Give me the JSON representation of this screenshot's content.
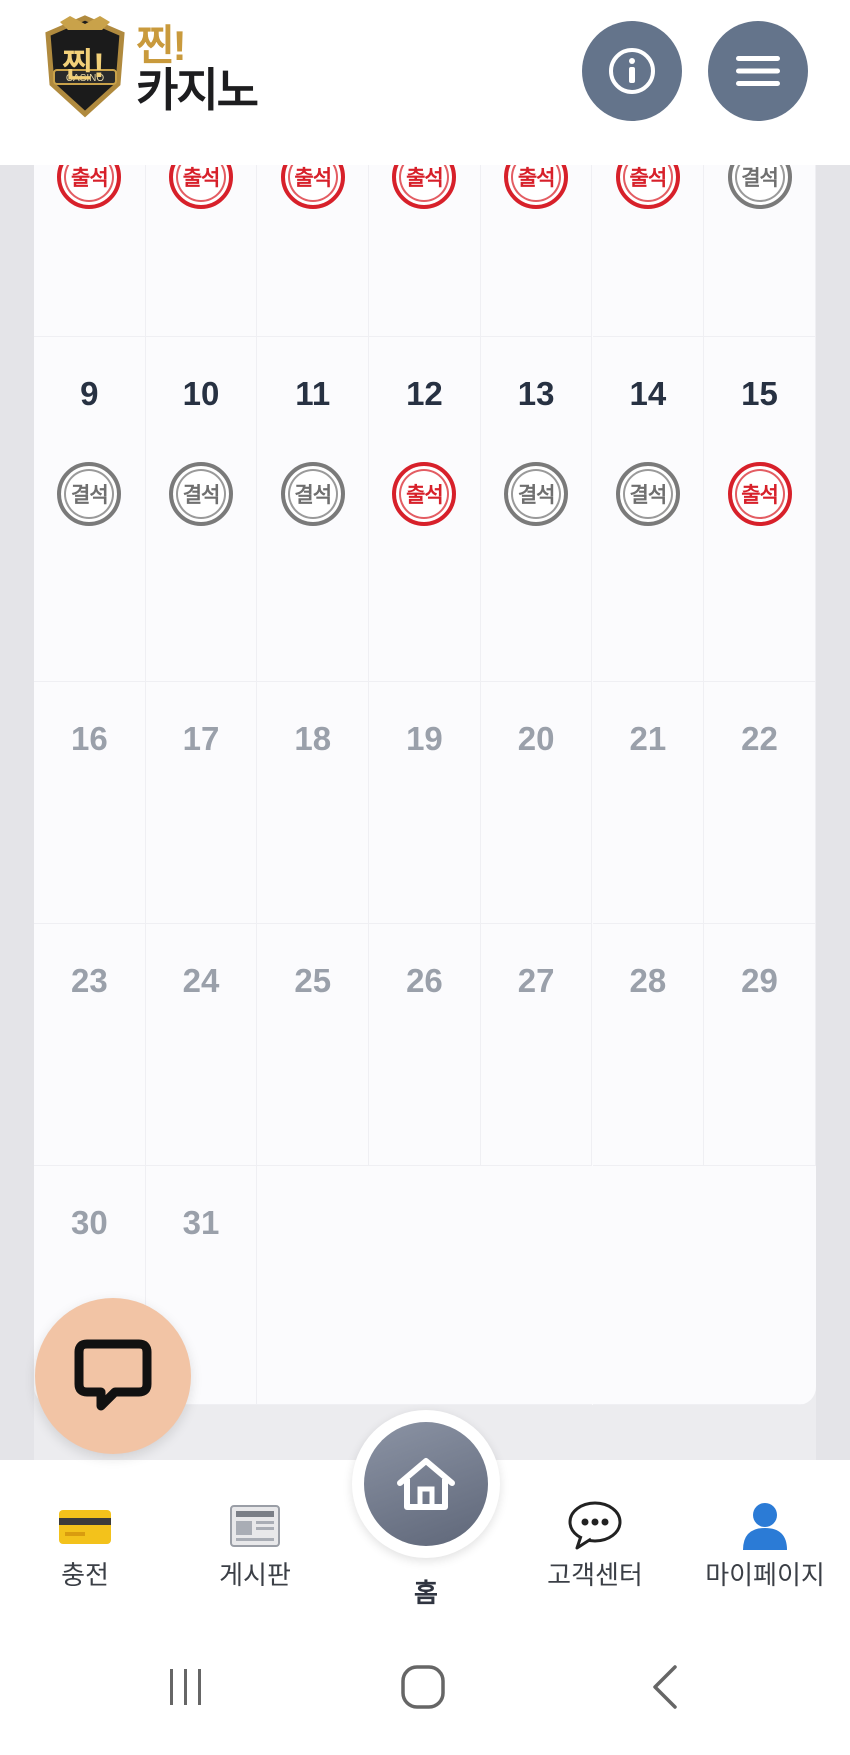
{
  "header": {
    "logo_line1": "찐!",
    "logo_line2": "카지노",
    "logo_badge": "CASINO",
    "info_icon": "info-icon",
    "menu_icon": "hamburger-menu-icon"
  },
  "calendar": {
    "stamp_attend_label": "출석",
    "stamp_absent_label": "결석",
    "first_row_stamps": [
      "attend",
      "attend",
      "attend",
      "attend",
      "attend",
      "attend",
      "absent"
    ],
    "weeks": [
      {
        "days": [
          "9",
          "10",
          "11",
          "12",
          "13",
          "14",
          "15"
        ],
        "stamps": [
          "absent",
          "absent",
          "absent",
          "attend",
          "absent",
          "absent",
          "attend"
        ],
        "past": true
      },
      {
        "days": [
          "16",
          "17",
          "18",
          "19",
          "20",
          "21",
          "22"
        ],
        "past": false
      },
      {
        "days": [
          "23",
          "24",
          "25",
          "26",
          "27",
          "28",
          "29"
        ],
        "past": false
      },
      {
        "days": [
          "30",
          "31"
        ],
        "past": false
      }
    ],
    "colors": {
      "attend": "#d7202a",
      "absent": "#7a7a7a"
    }
  },
  "chat_button": {
    "icon": "chat-bubble-icon",
    "color": "#f2c4a5"
  },
  "bottom_nav": {
    "items": [
      {
        "label": "충전",
        "icon": "credit-card-icon"
      },
      {
        "label": "게시판",
        "icon": "newspaper-icon"
      },
      {
        "label": "홈",
        "icon": "home-icon"
      },
      {
        "label": "고객센터",
        "icon": "speech-bubble-icon"
      },
      {
        "label": "마이페이지",
        "icon": "user-icon"
      }
    ]
  },
  "system_bar": {
    "recent": "recent-apps-icon",
    "home": "system-home-icon",
    "back": "back-icon"
  }
}
